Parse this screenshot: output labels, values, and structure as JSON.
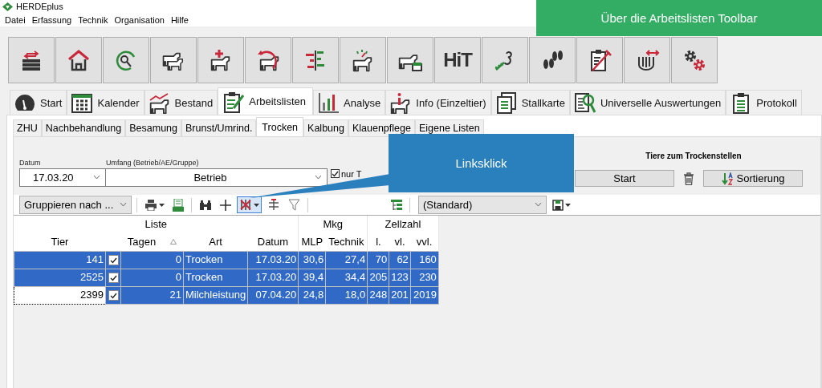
{
  "app": {
    "title": "HERDEplus"
  },
  "menu": [
    "Datei",
    "Erfassung",
    "Technik",
    "Organisation",
    "Hilfe"
  ],
  "banner": "Über die Arbeitslisten Toolbar",
  "toolbar": [
    {
      "kind": "transfer"
    },
    {
      "kind": "house"
    },
    {
      "kind": "arc"
    },
    {
      "kind": "cows"
    },
    {
      "kind": "cow-cross"
    },
    {
      "kind": "cow-arrow"
    },
    {
      "kind": "bars"
    },
    {
      "kind": "cow-gauge"
    },
    {
      "kind": "cow-trough"
    },
    {
      "kind": "text",
      "label": "HiT"
    },
    {
      "kind": "sprout"
    },
    {
      "kind": "hoof"
    },
    {
      "kind": "clipboard-syringe"
    },
    {
      "kind": "milking"
    },
    {
      "kind": "gears"
    }
  ],
  "main_tabs": [
    {
      "label": "Start",
      "kind": "gauge",
      "selected": false
    },
    {
      "label": "Kalender",
      "kind": "calendar",
      "selected": false
    },
    {
      "label": "Bestand",
      "kind": "herd",
      "selected": false
    },
    {
      "label": "Arbeitslisten",
      "kind": "clipboard-pen",
      "selected": true
    },
    {
      "label": "Analyse",
      "kind": "chart",
      "selected": false
    },
    {
      "label": "Info (Einzeltier)",
      "kind": "info",
      "selected": false
    },
    {
      "label": "Stallkarte",
      "kind": "cards",
      "selected": false
    },
    {
      "label": "Universelle Auswertungen",
      "kind": "search-doc",
      "selected": false
    },
    {
      "label": "Protokoll",
      "kind": "clipboard",
      "selected": false
    }
  ],
  "sub_tabs": [
    {
      "label": "ZHU",
      "selected": false
    },
    {
      "label": "Nachbehandlung",
      "selected": false
    },
    {
      "label": "Besamung",
      "selected": false
    },
    {
      "label": "Brunst/Umrind.",
      "selected": false
    },
    {
      "label": "Trocken",
      "selected": true
    },
    {
      "label": "Kalbung",
      "selected": false
    },
    {
      "label": "Klauenpflege",
      "selected": false
    },
    {
      "label": "Eigene Listen",
      "selected": false
    }
  ],
  "form": {
    "date_label": "Datum",
    "date": "17.03.20",
    "scope_label": "Umfang (Betrieb/AE/Gruppe)",
    "scope": "Betrieb",
    "option": {
      "label": "nur T",
      "checked": true
    },
    "panel_title": "Tiere zum Trockenstellen",
    "start_button": "Start",
    "sort_button": "Sortierung"
  },
  "grid_toolbar": {
    "group_by": "Gruppieren nach ...",
    "column_chooser_pressed": true,
    "view": "(Standard)"
  },
  "callout": "Linksklick",
  "table": {
    "groups": [
      {
        "label": "Liste",
        "columns": [
          {
            "label": "Tier",
            "kind": "number",
            "sorted": false
          },
          {
            "kind": "check"
          },
          {
            "label": "Tagen",
            "kind": "number",
            "sorted": true
          },
          {
            "label": "Art",
            "kind": "text",
            "sorted": false
          },
          {
            "label": "Datum",
            "kind": "number",
            "sorted": false
          }
        ]
      },
      {
        "label": "Mkg",
        "columns": [
          {
            "label": "MLP",
            "kind": "number",
            "sorted": false
          },
          {
            "label": "Technik",
            "kind": "number",
            "sorted": false
          }
        ]
      },
      {
        "label": "Zellzahl",
        "columns": [
          {
            "label": "l.",
            "kind": "number",
            "sorted": false
          },
          {
            "label": "vl.",
            "kind": "number",
            "sorted": false
          },
          {
            "label": "vvl.",
            "kind": "number",
            "sorted": false
          }
        ]
      }
    ],
    "rows": [
      {
        "selected": true,
        "current": false,
        "checked": true,
        "cells": [
          "141",
          "0",
          "Trocken",
          "17.03.20",
          "30,6",
          "27,4",
          "70",
          "62",
          "160"
        ]
      },
      {
        "selected": true,
        "current": false,
        "checked": true,
        "cells": [
          "2525",
          "0",
          "Trocken",
          "17.03.20",
          "39,4",
          "34,4",
          "205",
          "123",
          "230"
        ]
      },
      {
        "selected": true,
        "current": true,
        "checked": true,
        "cells": [
          "2399",
          "21",
          "Milchleistung",
          "07.04.20",
          "24,8",
          "18,0",
          "248",
          "201",
          "2019"
        ]
      }
    ]
  }
}
